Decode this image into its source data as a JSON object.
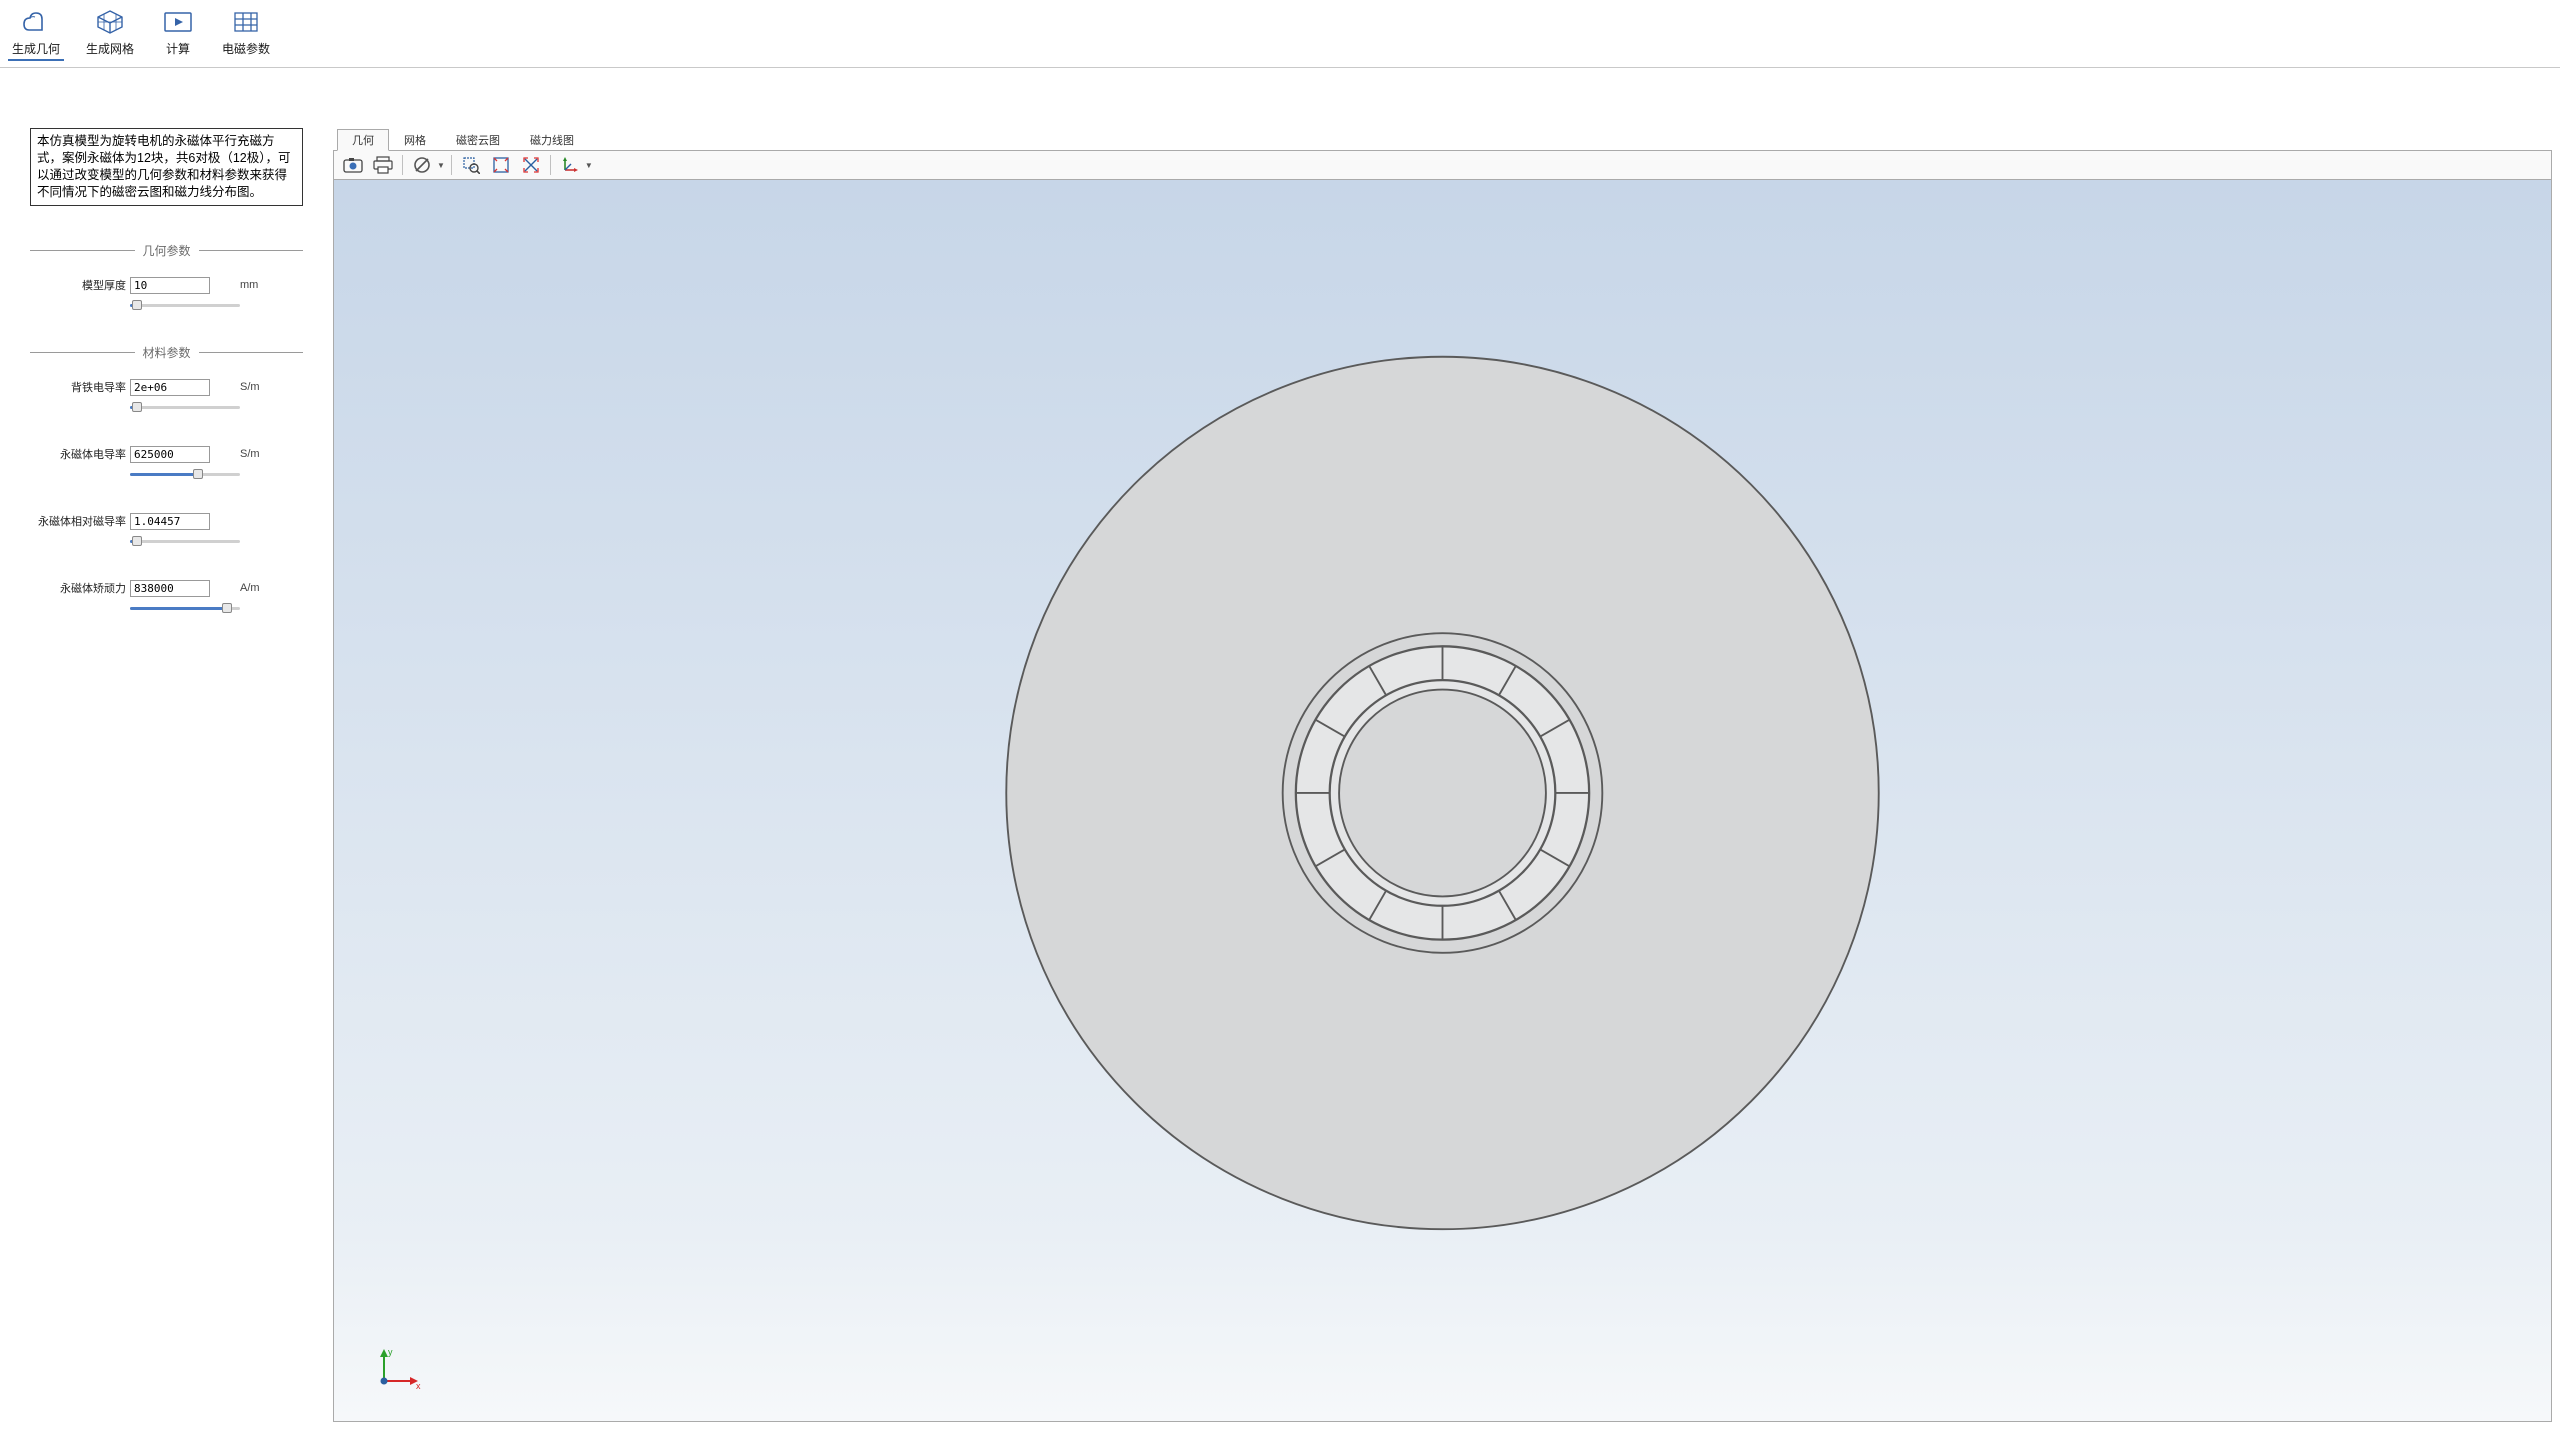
{
  "ribbon": [
    {
      "id": "gen-geom",
      "label": "生成几何"
    },
    {
      "id": "gen-mesh",
      "label": "生成网格"
    },
    {
      "id": "compute",
      "label": "计算"
    },
    {
      "id": "em-params",
      "label": "电磁参数"
    }
  ],
  "description": "本仿真模型为旋转电机的永磁体平行充磁方式，案例永磁体为12块，共6对极（12极），可以通过改变模型的几何参数和材料参数来获得不同情况下的磁密云图和磁力线分布图。",
  "sections": {
    "geom": "几何参数",
    "material": "材料参数"
  },
  "params": {
    "thickness": {
      "label": "模型厚度",
      "value": "10",
      "unit": "mm",
      "fill": 6
    },
    "back_iron": {
      "label": "背铁电导率",
      "value": "2e+06",
      "unit": "S/m",
      "fill": 6
    },
    "pm_cond": {
      "label": "永磁体电导率",
      "value": "625000",
      "unit": "S/m",
      "fill": 62
    },
    "pm_mur": {
      "label": "永磁体相对磁导率",
      "value": "1.04457",
      "unit": "",
      "fill": 6
    },
    "pm_hc": {
      "label": "永磁体矫顽力",
      "value": "838000",
      "unit": "A/m",
      "fill": 88
    }
  },
  "view_tabs": [
    {
      "id": "geom",
      "label": "几何",
      "active": true
    },
    {
      "id": "mesh",
      "label": "网格"
    },
    {
      "id": "bcloud",
      "label": "磁密云图"
    },
    {
      "id": "fluxline",
      "label": "磁力线图"
    }
  ],
  "axis": {
    "x": "x",
    "y": "y"
  }
}
